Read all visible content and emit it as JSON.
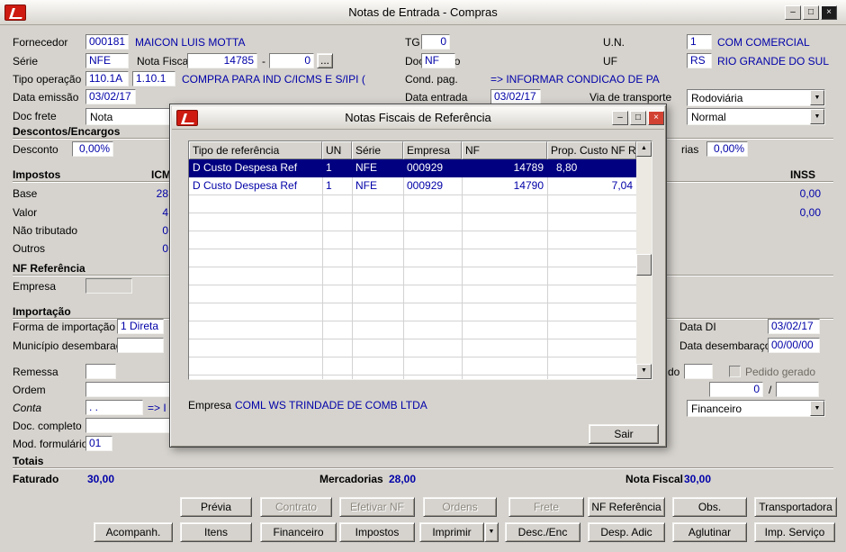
{
  "window": {
    "title": "Notas de Entrada - Compras"
  },
  "icons": {
    "minimize": "–",
    "maximize": "□",
    "close": "×",
    "dropdown": "▼",
    "scroll_up": "▲",
    "scroll_down": "▼",
    "ellipsis": "..."
  },
  "top": {
    "fornecedor_label": "Fornecedor",
    "fornecedor_code": "000181",
    "fornecedor_name": "MAICON LUIS MOTTA",
    "tg_label": "TG",
    "tg_value": "0",
    "un_label": "U.N.",
    "un_code": "1",
    "un_name": "COM COMERCIAL",
    "serie_label": "Série",
    "serie_value": "NFE",
    "nota_fiscal_label": "Nota Fiscal",
    "nota_fiscal_value": "14785",
    "dash": "-",
    "nota_fiscal_sub": "0",
    "documento_label": "Documento",
    "documento_value": "NF",
    "uf_label": "UF",
    "uf_code": "RS",
    "uf_name": "RIO GRANDE DO SUL",
    "tipo_operacao_label": "Tipo operação",
    "tipo_operacao_code1": "110.1A",
    "tipo_operacao_code2": "1.10.1",
    "tipo_operacao_desc": "COMPRA PARA IND C/ICMS E S/IPI (",
    "cond_pag_label": "Cond. pag.",
    "cond_pag_value": "=> INFORMAR CONDICAO DE PA",
    "data_emissao_label": "Data emissão",
    "data_emissao_value": "03/02/17",
    "data_entrada_label": "Data entrada",
    "data_entrada_value": "03/02/17",
    "via_transporte_label": "Via de transporte",
    "via_transporte_value": "Rodoviária",
    "doc_frete_label": "Doc frete",
    "doc_frete_value": "Nota",
    "modalidade_value": "Normal"
  },
  "descontos": {
    "section": "Descontos/Encargos",
    "desconto_label": "Desconto",
    "desconto_value": "0,00%",
    "right_label_partial": "rias",
    "right_value": "0,00%"
  },
  "impostos": {
    "section": "Impostos",
    "icms_header": "ICMS",
    "inss_header": "INSS",
    "base_label": "Base",
    "base_value": "28",
    "valor_label": "Valor",
    "valor_value": "4",
    "nao_trib_label": "Não tributado",
    "nao_trib_value": "0",
    "outros_label": "Outros",
    "outros_value": "0",
    "inss_value1": "0,00",
    "inss_value2": "0,00"
  },
  "nf_ref": {
    "section": "NF Referência",
    "empresa_label": "Empresa"
  },
  "importacao": {
    "section": "Importação",
    "forma_label": "Forma de importação",
    "forma_value": "1 Direta",
    "municipio_label": "Município desembaraço",
    "data_di_label": "Data DI",
    "data_di_value": "03/02/17",
    "data_desemb_label": "Data desembaraço",
    "data_desemb_value": "00/00/00"
  },
  "misc": {
    "remessa_label": "Remessa",
    "pedido_label_partial": "do",
    "pedido_gerado_label": "Pedido gerado",
    "ordem_label": "Ordem",
    "pedido_num": "0",
    "slash": "/",
    "conta_label": "Conta",
    "conta_value": ". .",
    "conta_hint": "=> I",
    "financeiro_value": "Financeiro",
    "doc_completo_label": "Doc. completo",
    "mod_form_label": "Mod. formulário",
    "mod_form_value": "01"
  },
  "totais": {
    "section": "Totais",
    "faturado_label": "Faturado",
    "faturado_value": "30,00",
    "mercadorias_label": "Mercadorias",
    "mercadorias_value": "28,00",
    "nota_fiscal_label": "Nota Fiscal",
    "nota_fiscal_value": "30,00"
  },
  "buttons": {
    "row1": [
      {
        "label": "Prévia"
      },
      {
        "label": "Contrato"
      },
      {
        "label": "Efetivar NF"
      },
      {
        "label": "Ordens"
      },
      {
        "label": "Frete"
      },
      {
        "label": "NF Referência"
      },
      {
        "label": "Obs."
      },
      {
        "label": "Transportadora"
      }
    ],
    "row2": [
      {
        "label": "Acompanh."
      },
      {
        "label": "Itens"
      },
      {
        "label": "Financeiro"
      },
      {
        "label": "Impostos"
      },
      {
        "label": "Imprimir"
      },
      {
        "label": "Desc./Enc"
      },
      {
        "label": "Desp. Adic"
      },
      {
        "label": "Aglutinar"
      },
      {
        "label": "Imp. Serviço"
      }
    ]
  },
  "dialog": {
    "title": "Notas Fiscais de Referência",
    "headers": [
      "Tipo de referência",
      "UN",
      "Série",
      "Empresa",
      "NF",
      "Prop. Custo NF Ref."
    ],
    "rows": [
      {
        "tipo": "D Custo Despesa Ref",
        "un": "1",
        "serie": "NFE",
        "empresa": "000929",
        "nf": "14789",
        "prop": "8,80"
      },
      {
        "tipo": "D Custo Despesa Ref",
        "un": "1",
        "serie": "NFE",
        "empresa": "000929",
        "nf": "14790",
        "prop": "7,04"
      }
    ],
    "empresa_label": "Empresa",
    "empresa_value": "COML WS TRINDADE DE COMB LTDA",
    "sair": "Sair"
  }
}
